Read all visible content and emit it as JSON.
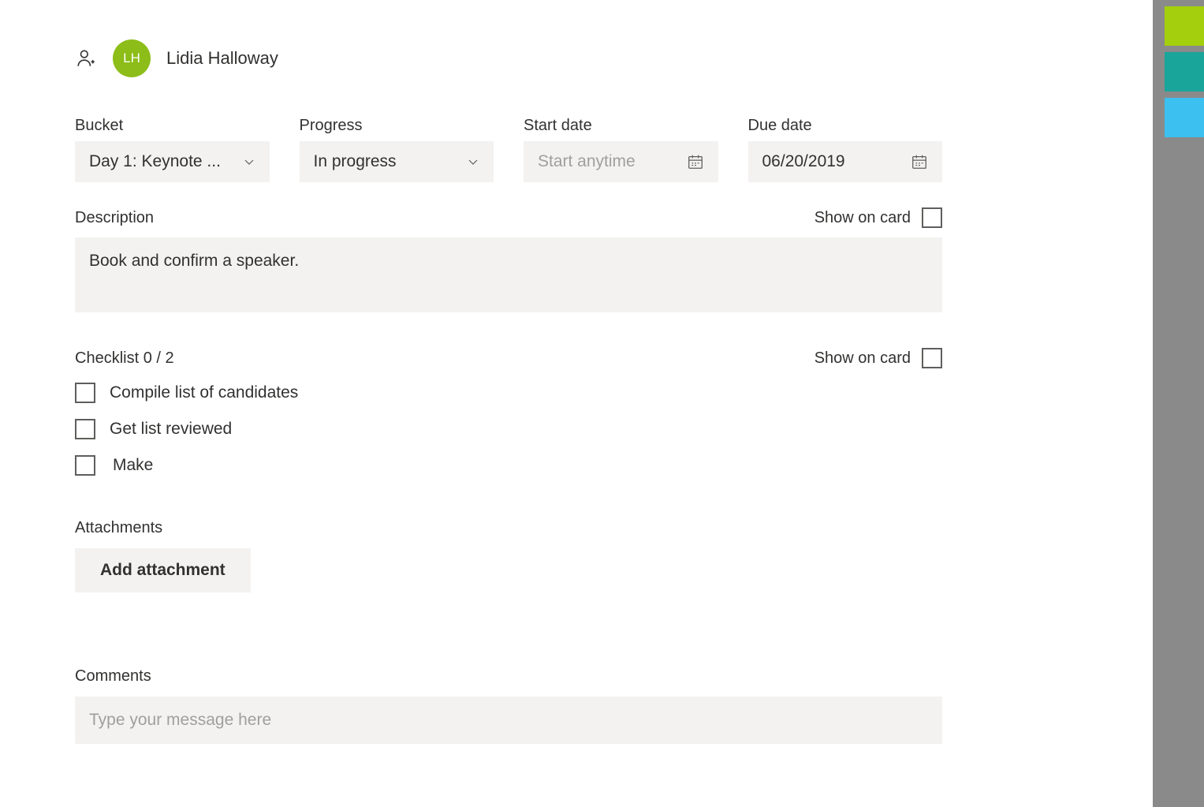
{
  "assignee": {
    "initials": "LH",
    "name": "Lidia Halloway"
  },
  "fields": {
    "bucket": {
      "label": "Bucket",
      "value": "Day 1: Keynote ..."
    },
    "progress": {
      "label": "Progress",
      "value": "In progress"
    },
    "start_date": {
      "label": "Start date",
      "placeholder": "Start anytime",
      "value": ""
    },
    "due_date": {
      "label": "Due date",
      "value": "06/20/2019"
    }
  },
  "description": {
    "label": "Description",
    "show_on_card_label": "Show on card",
    "text": "Book and confirm a speaker."
  },
  "checklist": {
    "label": "Checklist 0 / 2",
    "show_on_card_label": "Show on card",
    "items": [
      {
        "text": "Compile list of candidates",
        "checked": false
      },
      {
        "text": "Get list reviewed",
        "checked": false
      },
      {
        "text": "Make",
        "checked": false,
        "editing": true
      }
    ]
  },
  "attachments": {
    "label": "Attachments",
    "button_label": "Add attachment"
  },
  "comments": {
    "label": "Comments",
    "placeholder": "Type your message here"
  },
  "colors": {
    "tabs": [
      "#a4cf0c",
      "#1aa59a",
      "#3bc0f0"
    ]
  }
}
